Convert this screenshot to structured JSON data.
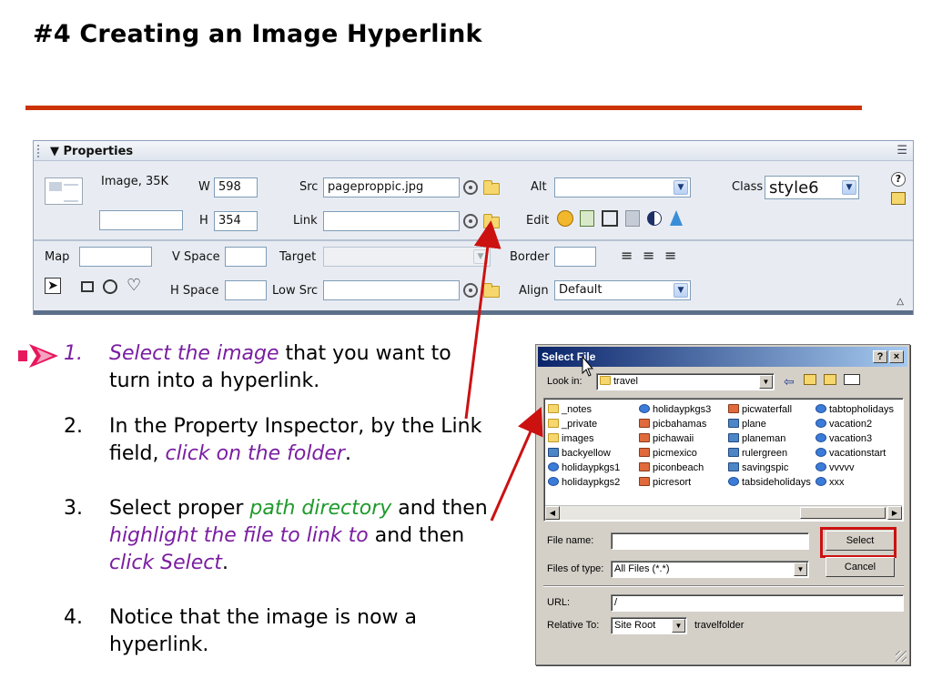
{
  "slide": {
    "title": "#4  Creating an Image Hyperlink"
  },
  "properties": {
    "panel_title": "▼ Properties",
    "image_info": "Image, 35K",
    "image_name_value": "",
    "w_label": "W",
    "w_value": "598",
    "h_label": "H",
    "h_value": "354",
    "src_label": "Src",
    "src_value": "pageproppic.jpg",
    "link_label": "Link",
    "link_value": "",
    "alt_label": "Alt",
    "alt_value": "",
    "edit_label": "Edit",
    "class_label": "Class",
    "class_value": "style6",
    "map_label": "Map",
    "map_value": "",
    "vspace_label": "V Space",
    "vspace_value": "",
    "hspace_label": "H Space",
    "hspace_value": "",
    "target_label": "Target",
    "target_value": "",
    "lowsrc_label": "Low Src",
    "lowsrc_value": "",
    "border_label": "Border",
    "border_value": "",
    "align_label": "Align",
    "align_value": "Default",
    "help_glyph": "?"
  },
  "steps": [
    {
      "num": "1.",
      "parts": [
        {
          "text": "Select the image",
          "style": "em purple"
        },
        {
          "text": " that you want to turn into a hyperlink.",
          "style": ""
        }
      ]
    },
    {
      "num": "2.",
      "parts": [
        {
          "text": "In the Property Inspector, by the Link field, ",
          "style": ""
        },
        {
          "text": "click on the folder",
          "style": "em purple"
        },
        {
          "text": ".",
          "style": ""
        }
      ]
    },
    {
      "num": "3.",
      "parts": [
        {
          "text": "Select proper ",
          "style": ""
        },
        {
          "text": "path directory",
          "style": "em green"
        },
        {
          "text": " and then ",
          "style": ""
        },
        {
          "text": "highlight the file to link to",
          "style": "em purple"
        },
        {
          "text": " and then ",
          "style": ""
        },
        {
          "text": "click Select",
          "style": "em purple"
        },
        {
          "text": ".",
          "style": ""
        }
      ]
    },
    {
      "num": "4.",
      "parts": [
        {
          "text": "Notice that the image is now a hyperlink.",
          "style": ""
        }
      ]
    }
  ],
  "dialog": {
    "title": "Select File",
    "help_btn": "?",
    "close_btn": "×",
    "look_in_label": "Look in:",
    "look_in_value": "travel",
    "files_col1": [
      "_notes",
      "_private",
      "images",
      "backyellow",
      "holidaypkgs1",
      "holidaypkgs2"
    ],
    "files_col2": [
      "holidaypkgs3",
      "picbahamas",
      "pichawaii",
      "picmexico",
      "piconbeach",
      "picresort"
    ],
    "files_col3": [
      "picwaterfall",
      "plane",
      "planeman",
      "rulergreen",
      "savingspic",
      "tabsideholidays"
    ],
    "files_col4": [
      "tabtopholidays",
      "vacation2",
      "vacation3",
      "vacationstart",
      "vvvvv",
      "xxx"
    ],
    "file_name_label": "File name:",
    "file_name_value": "",
    "files_of_type_label": "Files of type:",
    "files_of_type_value": "All Files (*.*)",
    "select_btn": "Select",
    "cancel_btn": "Cancel",
    "url_label": "URL:",
    "url_value": "/",
    "relative_to_label": "Relative To:",
    "relative_to_value": "Site Root",
    "relative_folder": "travelfolder"
  },
  "colors": {
    "title_rule": "#cc3300",
    "purple_text": "#7a1ea1",
    "green_text": "#1f9a2c",
    "annotation_red": "#cc1111"
  }
}
